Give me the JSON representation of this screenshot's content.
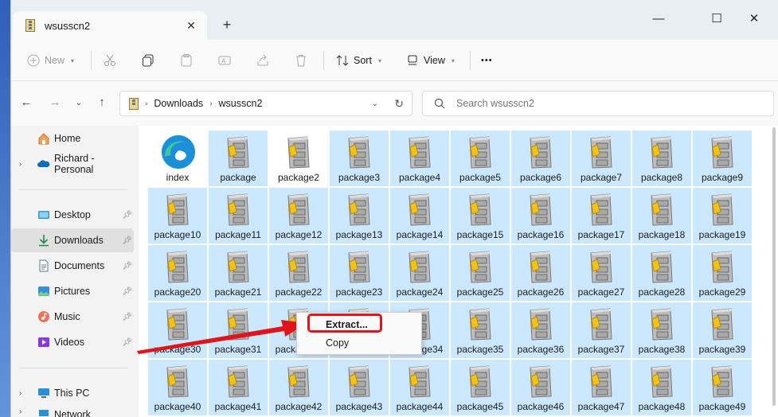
{
  "tab": {
    "title": "wsusscn2",
    "close": "✕",
    "new_tab": "+"
  },
  "window_controls": {
    "minimize": "—",
    "maximize": "☐",
    "close": "✕"
  },
  "toolbar": {
    "new_label": "New",
    "sort_label": "Sort",
    "view_label": "View",
    "more": "•••"
  },
  "address": {
    "crumbs": [
      "Downloads",
      "wsusscn2"
    ],
    "separator": "›"
  },
  "search": {
    "placeholder": "Search wsusscn2"
  },
  "sidebar": {
    "items": [
      {
        "label": "Home",
        "icon": "home-icon"
      },
      {
        "label": "Richard - Personal",
        "icon": "onedrive-icon"
      },
      {
        "label": "Desktop",
        "icon": "desktop-icon"
      },
      {
        "label": "Downloads",
        "icon": "downloads-icon"
      },
      {
        "label": "Documents",
        "icon": "documents-icon"
      },
      {
        "label": "Pictures",
        "icon": "pictures-icon"
      },
      {
        "label": "Music",
        "icon": "music-icon"
      },
      {
        "label": "Videos",
        "icon": "videos-icon"
      },
      {
        "label": "This PC",
        "icon": "this-pc-icon"
      },
      {
        "label": "Network",
        "icon": "network-icon"
      }
    ]
  },
  "files": [
    "index",
    "package",
    "package2",
    "package3",
    "package4",
    "package5",
    "package6",
    "package7",
    "package8",
    "package9",
    "package10",
    "package11",
    "package12",
    "package13",
    "package14",
    "package15",
    "package16",
    "package17",
    "package18",
    "package19",
    "package20",
    "package21",
    "package22",
    "package23",
    "package24",
    "package25",
    "package26",
    "package27",
    "package28",
    "package29",
    "package30",
    "package31",
    "package32",
    "package33",
    "package34",
    "package35",
    "package36",
    "package37",
    "package38",
    "package39",
    "package40",
    "package41",
    "package42",
    "package43",
    "package44",
    "package45",
    "package46",
    "package47",
    "package48",
    "package49"
  ],
  "context_menu": {
    "extract": "Extract...",
    "copy": "Copy"
  },
  "colors": {
    "selection": "#cce8ff",
    "highlight": "#e0151b",
    "accent": "#0067c0"
  }
}
